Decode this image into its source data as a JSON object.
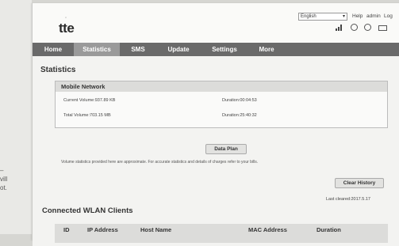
{
  "left_page": {
    "lines": [
      "–",
      "vill",
      "ot."
    ]
  },
  "header": {
    "logo": "tte",
    "language": "English",
    "links": [
      "Help",
      "admin",
      "Log"
    ]
  },
  "nav": {
    "items": [
      "Home",
      "Statistics",
      "SMS",
      "Update",
      "Settings",
      "More"
    ],
    "active": "Statistics"
  },
  "statistics": {
    "title": "Statistics",
    "mobile_network": {
      "header": "Mobile Network",
      "current_volume": "Current Volume:937.89 KB",
      "duration_current": "Duration:00:04:53",
      "total_volume": "Total Volume:703.15 MB",
      "duration_total": "Duration:25:40:32"
    },
    "data_plan_button": "Data Plan",
    "note": "Volume statistics provided here are approximate. For accurate statistics and details of charges refer to your bills.",
    "clear_history_button": "Clear History",
    "last_cleared": "Last cleared:2017.5.17"
  },
  "wlan_clients": {
    "title": "Connected WLAN Clients",
    "columns": [
      "ID",
      "IP Address",
      "Host Name",
      "MAC Address",
      "Duration"
    ]
  }
}
